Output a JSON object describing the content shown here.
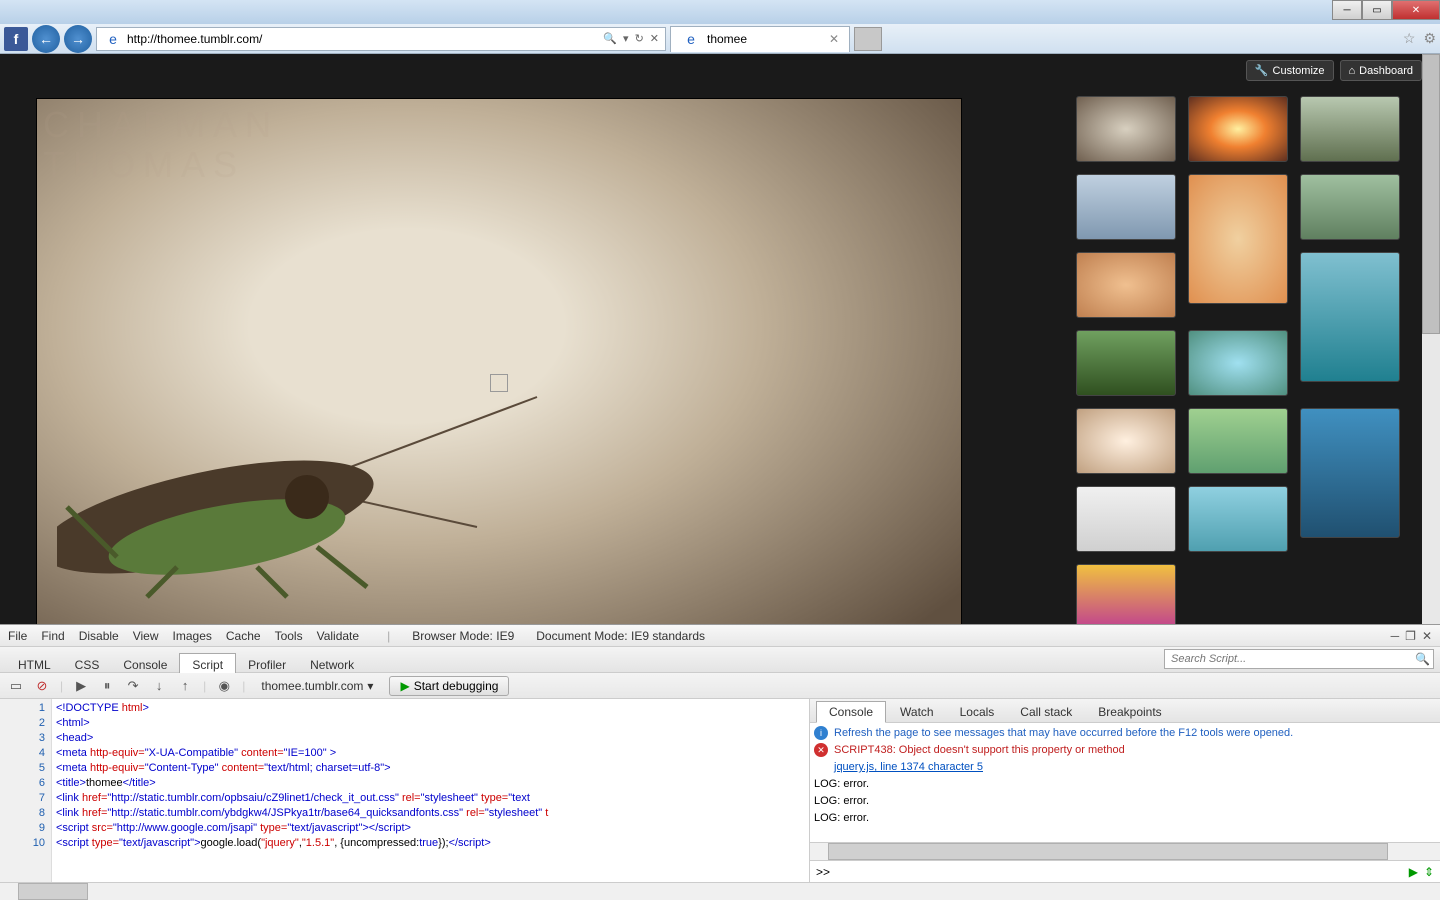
{
  "browser": {
    "url": "http://thomee.tumblr.com/",
    "tab_title": "thomee",
    "fb": "f"
  },
  "page": {
    "customize": "Customize",
    "dashboard": "Dashboard",
    "watermark_line1": "CHAPMAN",
    "watermark_line2": "THOMAS",
    "thumbs": [
      {
        "bg": "radial-gradient(#d8d0c0,#706050)"
      },
      {
        "bg": "radial-gradient(#fff0a0,#f08030 40%,#603020)"
      },
      {
        "bg": "linear-gradient(#b8c8b0,#607050)"
      },
      {
        "bg": "linear-gradient(#c0d0e0,#8098b0)"
      },
      {
        "bg": "radial-gradient(#f0d0a0,#e09050)",
        "tall": true
      },
      {
        "bg": "linear-gradient(#a0c0a0,#608060)"
      },
      {
        "bg": "radial-gradient(#f0c090,#c08050)"
      },
      {
        "bg": "linear-gradient(#80c0d0,#208090)",
        "tall": true
      },
      {
        "bg": "linear-gradient(#70a060,#305020)"
      },
      {
        "bg": "radial-gradient(#a0e0f0,#509080)"
      },
      {
        "bg": "radial-gradient(#fff0e0,#c0a080)"
      },
      {
        "bg": "linear-gradient(#a0d090,#60a070)"
      },
      {
        "bg": "linear-gradient(#4090c0,#205070)",
        "tall": true
      },
      {
        "bg": "linear-gradient(#f0f0f0,#d0d0d0)"
      },
      {
        "bg": "linear-gradient(#90d0e0,#50a0b0)"
      },
      {
        "bg": "linear-gradient(#f0c040,#c04090)"
      }
    ]
  },
  "devtools": {
    "menu": [
      "File",
      "Find",
      "Disable",
      "View",
      "Images",
      "Cache",
      "Tools",
      "Validate"
    ],
    "browser_mode_label": "Browser Mode:",
    "browser_mode": "IE9",
    "doc_mode_label": "Document Mode:",
    "doc_mode": "IE9 standards",
    "tabs": [
      "HTML",
      "CSS",
      "Console",
      "Script",
      "Profiler",
      "Network"
    ],
    "active_tab": "Script",
    "search_placeholder": "Search Script...",
    "script_dropdown": "thomee.tumblr.com",
    "debug_btn": "Start debugging",
    "code_lines": [
      {
        "n": 1,
        "html": "<span class='kw'>&lt;!DOCTYPE</span> <span class='attr'>html</span><span class='kw'>&gt;</span>"
      },
      {
        "n": 2,
        "html": "<span class='kw'>&lt;html&gt;</span>"
      },
      {
        "n": 3,
        "html": "<span class='kw'>&lt;head&gt;</span>"
      },
      {
        "n": 4,
        "html": "<span class='kw'>&lt;meta</span> <span class='attr'>http-equiv=</span><span class='val'>\"X-UA-Compatible\"</span> <span class='attr'>content=</span><span class='val'>\"IE=100\"</span> <span class='kw'>&gt;</span>"
      },
      {
        "n": 5,
        "html": "<span class='kw'>&lt;meta</span> <span class='attr'>http-equiv=</span><span class='val'>\"Content-Type\"</span> <span class='attr'>content=</span><span class='val'>\"text/html; charset=utf-8\"</span><span class='kw'>&gt;</span>"
      },
      {
        "n": 6,
        "html": "<span class='kw'>&lt;title&gt;</span><span class='txt'>thomee</span><span class='kw'>&lt;/title&gt;</span>"
      },
      {
        "n": 7,
        "html": "<span class='kw'>&lt;link</span> <span class='attr'>href=</span><span class='val'>\"http://static.tumblr.com/opbsaiu/cZ9linet1/check_it_out.css\"</span> <span class='attr'>rel=</span><span class='val'>\"stylesheet\"</span> <span class='attr'>type=</span><span class='val'>\"text</span>"
      },
      {
        "n": 8,
        "html": "<span class='kw'>&lt;link</span> <span class='attr'>href=</span><span class='val'>\"http://static.tumblr.com/ybdgkw4/JSPkya1tr/base64_quicksandfonts.css\"</span> <span class='attr'>rel=</span><span class='val'>\"stylesheet\"</span> <span class='attr'>t</span>"
      },
      {
        "n": 9,
        "html": "<span class='kw'>&lt;script</span> <span class='attr'>src=</span><span class='val'>\"http://www.google.com/jsapi\"</span> <span class='attr'>type=</span><span class='val'>\"text/javascript\"</span><span class='kw'>&gt;&lt;/script&gt;</span>"
      },
      {
        "n": 10,
        "html": "<span class='kw'>&lt;script</span> <span class='attr'>type=</span><span class='val'>\"text/javascript\"</span><span class='kw'>&gt;</span><span class='txt'>google.load(</span><span class='attr'>\"jquery\"</span><span class='txt'>,</span><span class='attr'>\"1.5.1\"</span><span class='txt'>, {uncompressed:</span><span class='kw'>true</span><span class='txt'>});</span><span class='kw'>&lt;/script&gt;</span>"
      }
    ],
    "right_tabs": [
      "Console",
      "Watch",
      "Locals",
      "Call stack",
      "Breakpoints"
    ],
    "active_right_tab": "Console",
    "console_info": "Refresh the page to see messages that may have occurred before the F12 tools were opened.",
    "console_error": "SCRIPT438: Object doesn't support this property or method",
    "console_error_link": "jquery.js, line 1374 character 5",
    "console_logs": [
      "LOG: error.",
      "LOG: error.",
      "LOG: error."
    ],
    "prompt": ">>"
  }
}
